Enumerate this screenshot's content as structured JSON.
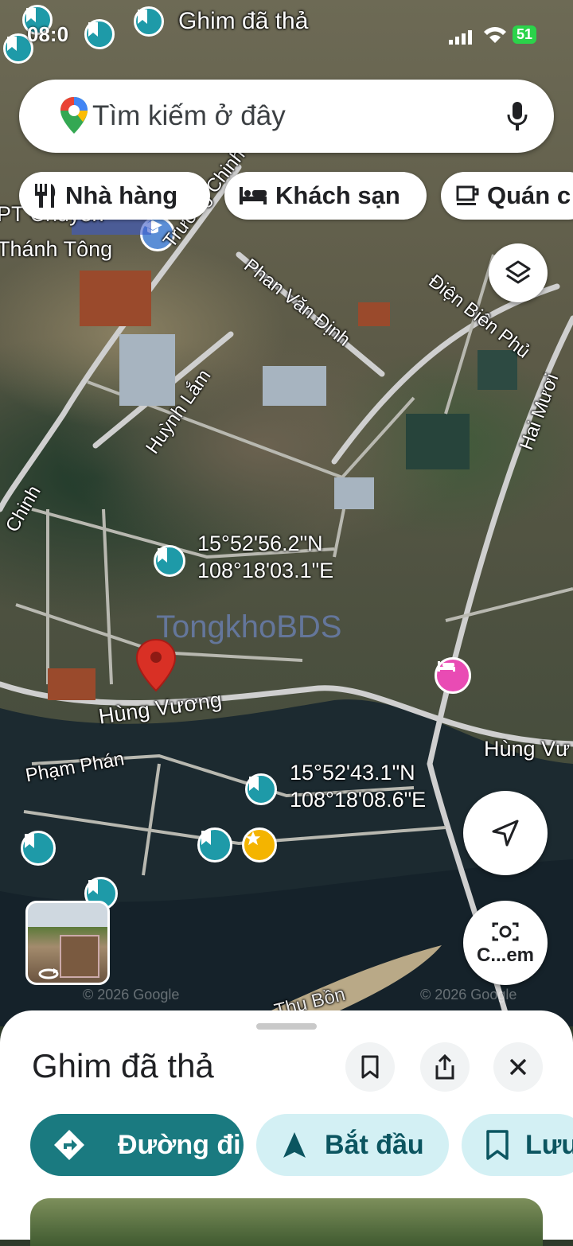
{
  "status_bar": {
    "time": "08:0",
    "battery": "51"
  },
  "top_banner": {
    "label": "Ghim đã thả"
  },
  "search": {
    "placeholder": "Tìm kiếm ở đây"
  },
  "chips": [
    {
      "label": "Nhà hàng",
      "icon": "fork-knife-icon"
    },
    {
      "label": "Khách sạn",
      "icon": "bed-icon"
    },
    {
      "label": "Quán c",
      "icon": "coffee-cup-icon"
    }
  ],
  "map": {
    "labels": {
      "school_line1": "PT Chuyên",
      "school_line2": "Thánh Tông",
      "truong_chinh": "Trường Chinh",
      "phan_van_dinh": "Phan Văn Định",
      "dien_bien_phu": "Điện Biên Phủ",
      "huynh_lam": "Huỳnh Lắm",
      "hai_muoi": "Hai Mươi",
      "chinh": "Chinh",
      "hung_vuong": "Hùng Vương",
      "hung_vuong_right": "Hùng Vư",
      "pham_phan": "Phạm Phán",
      "thu_bon": "Thu Bồn",
      "watermark": "TongkhoBDS",
      "copyright_left": "© 2026 Google",
      "copyright_right": "© 2026 Google"
    },
    "coords_1": {
      "lat": "15°52'56.2\"N",
      "lng": "108°18'03.1\"E"
    },
    "coords_2": {
      "lat": "15°52'43.1\"N",
      "lng": "108°18'08.6\"E"
    }
  },
  "camera_button": {
    "label": "C...em"
  },
  "sheet": {
    "title": "Ghim đã thả",
    "actions": [
      {
        "label": "Đường đi",
        "icon": "directions-icon"
      },
      {
        "label": "Bắt đầu",
        "icon": "navigation-arrow-icon"
      },
      {
        "label": "Lưu",
        "icon": "bookmark-icon"
      }
    ]
  },
  "colors": {
    "accent_dark": "#1a7a80",
    "accent_light": "#d3f0f4",
    "pin_teal": "#1e9aa8",
    "drop_pin_red": "#d93025"
  }
}
